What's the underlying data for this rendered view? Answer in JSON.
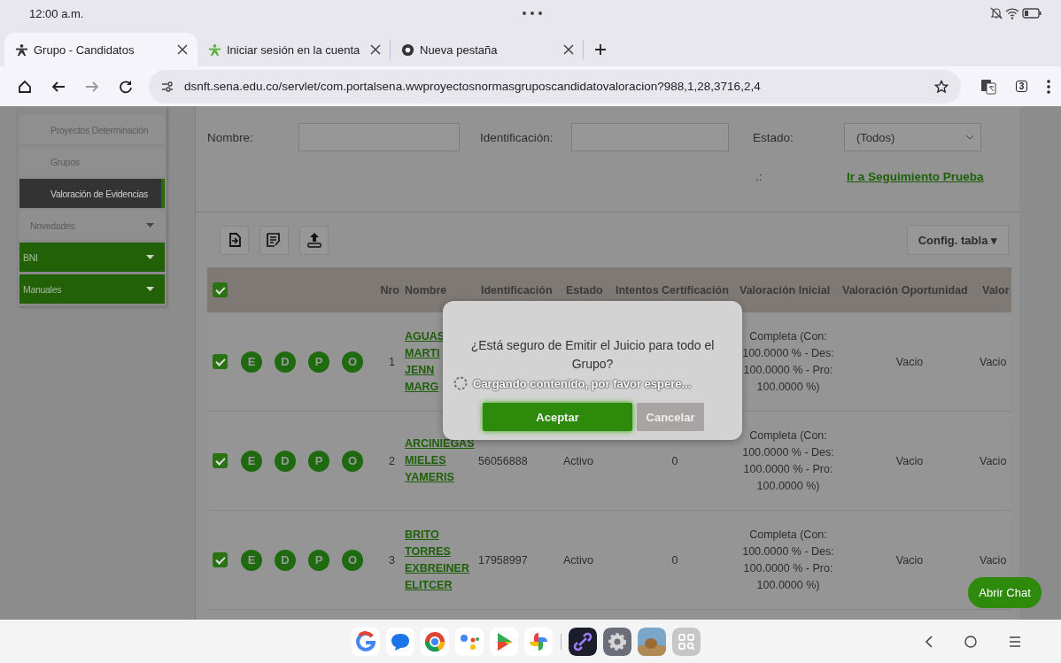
{
  "status_bar": {
    "time": "12:00 a.m."
  },
  "tabs": [
    {
      "title": "Grupo - Candidatos",
      "selected": true,
      "kind": "site"
    },
    {
      "title": "Iniciar sesión en la cuenta",
      "selected": false,
      "kind": "site"
    },
    {
      "title": "Nueva pestaña",
      "selected": false,
      "kind": "newtab"
    }
  ],
  "address_bar": {
    "url": "dsnft.sena.edu.co/servlet/com.portalsena.wwproyectosnormasgruposcandidatovaloracion?988,1,28,3716,2,4",
    "tab_count": "3"
  },
  "sidebar": {
    "items": [
      {
        "label": "Proyectos Determinación",
        "kind": "link",
        "selected": false
      },
      {
        "label": "Grupos",
        "kind": "link",
        "selected": false
      },
      {
        "label": "Valoración de Evidencias",
        "kind": "link",
        "selected": true
      },
      {
        "label": "Novedades",
        "kind": "submenu",
        "selected": false
      },
      {
        "label": "BNI",
        "kind": "menu",
        "selected": false
      },
      {
        "label": "Manuales",
        "kind": "menu",
        "selected": false
      }
    ]
  },
  "filters": {
    "nombre_label": "Nombre:",
    "identificacion_label": "Identificación:",
    "estado_label": "Estado:",
    "estado_value": "(Todos)",
    "extra_label": ".:",
    "link": "Ir a Seguimiento Prueba"
  },
  "toolbar": {
    "config_button": "Config. tabla ▾"
  },
  "table": {
    "select_all_checked": true,
    "columns": [
      "Nro",
      "Nombre",
      "Identificación",
      "Estado",
      "Intentos Certificación",
      "Valoración Inicial",
      "Valoración Oportunidad",
      "Valor"
    ],
    "rows": [
      {
        "checked": true,
        "actions": [
          "E",
          "D",
          "P",
          "O"
        ],
        "nro": "1",
        "nombre": "AGUAS MARTI JENN MARG",
        "valoracion_inicial": "Completa (Con: 100.0000 % - Des: 100.0000 % - Pro: 100.0000 %)",
        "valoracion_oportunidad": "Vacio",
        "column_10": "Vacio"
      },
      {
        "checked": true,
        "actions": [
          "E",
          "D",
          "P",
          "O"
        ],
        "nro": "2",
        "nombre": "ARCINIEGAS MIELES YAMERIS",
        "identificacion": "56056888",
        "estado": "Activo",
        "intentos": "0",
        "valoracion_inicial": "Completa (Con: 100.0000 % - Des: 100.0000 % - Pro: 100.0000 %)",
        "valoracion_oportunidad": "Vacio",
        "column_10": "Vacio"
      },
      {
        "checked": true,
        "actions": [
          "E",
          "D",
          "P",
          "O"
        ],
        "nro": "3",
        "nombre": "BRITO TORRES EXBREINER ELITCER",
        "identificacion": "17958997",
        "estado": "Activo",
        "intentos": "0",
        "valoracion_inicial": "Completa (Con: 100.0000 % - Des: 100.0000 % - Pro: 100.0000 %)",
        "valoracion_oportunidad": "Vacio",
        "column_10": "Vacio"
      }
    ]
  },
  "dialog": {
    "message": "¿Está seguro de Emitir el Juicio para todo el Grupo?",
    "buttons": [
      {
        "label": "Aceptar",
        "kind": "primary"
      },
      {
        "label": "Cancelar",
        "kind": "secondary"
      }
    ]
  },
  "loading": {
    "message": "Cargando contenido, por favor espere..."
  },
  "chat_button": "Abrir Chat"
}
